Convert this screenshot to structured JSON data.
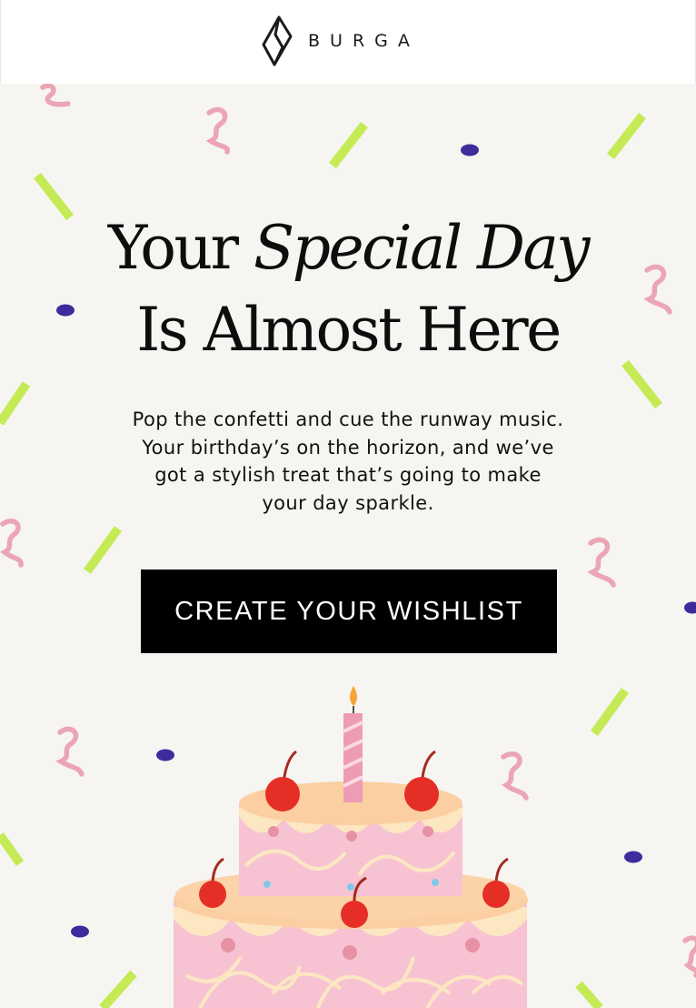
{
  "brand": {
    "name": "BURGA",
    "logo_icon": "burga-diamond-logo"
  },
  "hero": {
    "headline_line1_plain": "Your ",
    "headline_line1_italic": "Special Day",
    "headline_line2": "Is Almost Here",
    "body_lines": [
      "Pop the confetti and cue the runway music.",
      "Your birthday’s on the horizon, and we’ve",
      "got a stylish treat that’s going to make",
      "your day sparkle."
    ],
    "cta_label": "CREATE YOUR WISHLIST",
    "illustration": "birthday-cake-with-cherries-and-candle"
  },
  "colors": {
    "background": "#f6f5f2",
    "confetti_green": "#c4eb55",
    "confetti_pink": "#eba5b4",
    "confetti_blue": "#3f2b9c",
    "button_bg": "#000000",
    "button_text": "#ffffff",
    "cake_pink": "#f7c3d2",
    "cake_cream": "#fce7c2",
    "cake_top": "#fbcfa2",
    "cherry_red": "#e52f26"
  }
}
